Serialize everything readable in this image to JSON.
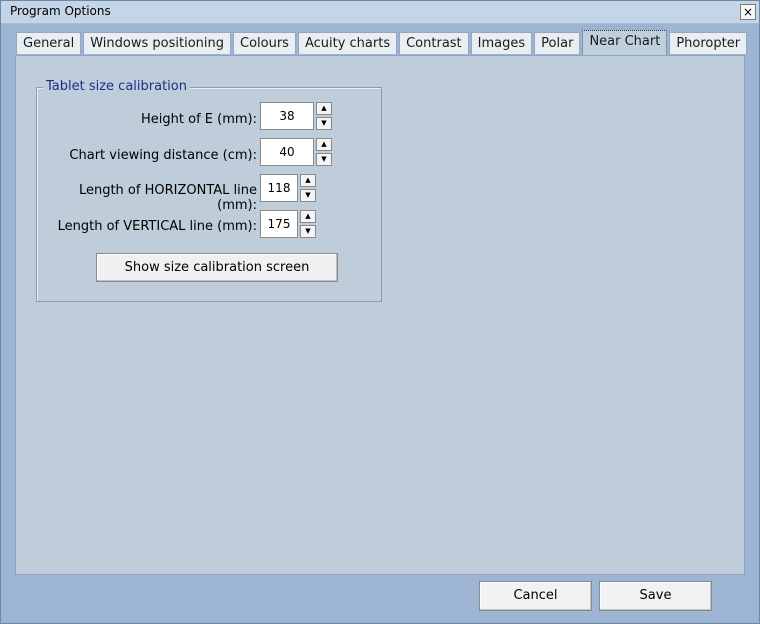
{
  "window": {
    "title": "Program Options",
    "close_glyph": "×"
  },
  "tabs": [
    {
      "label": "General"
    },
    {
      "label": "Windows positioning"
    },
    {
      "label": "Colours"
    },
    {
      "label": "Acuity charts"
    },
    {
      "label": "Contrast"
    },
    {
      "label": "Images"
    },
    {
      "label": "Polar"
    },
    {
      "label": "Near Chart",
      "active": true
    },
    {
      "label": "Phoropter"
    }
  ],
  "group": {
    "title": "Tablet size calibration",
    "fields": [
      {
        "label": "Height of E (mm):",
        "value": "38"
      },
      {
        "label": "Chart viewing distance (cm):",
        "value": "40"
      },
      {
        "label": "Length of HORIZONTAL line (mm):",
        "value": "118"
      },
      {
        "label": "Length of VERTICAL line (mm):",
        "value": "175"
      }
    ],
    "button_label": "Show size calibration screen"
  },
  "spin_glyphs": {
    "up": "▲",
    "down": "▼"
  },
  "footer": {
    "cancel_label": "Cancel",
    "save_label": "Save"
  }
}
